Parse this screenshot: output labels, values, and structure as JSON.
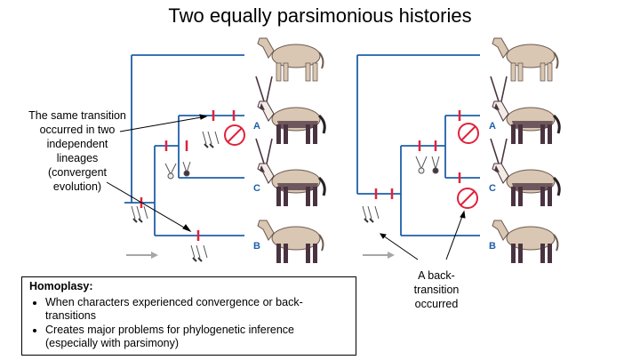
{
  "title": "Two equally parsimonious histories",
  "left_tree": {
    "tip_labels": [
      "A",
      "C",
      "B"
    ],
    "callout": "The same transition occurred in two independent lineages (convergent evolution)"
  },
  "right_tree": {
    "tip_labels": [
      "A",
      "C",
      "B"
    ],
    "callout": "A back-transition occurred"
  },
  "homoplasy": {
    "heading": "Homoplasy:",
    "bullets": [
      "When characters experienced convergence or back-transitions",
      "Creates major problems for phylogenetic inference (especially with parsimony)"
    ]
  },
  "colors": {
    "branch": "#1f5fa8",
    "transition_mark": "#e0223c",
    "animal_body": "#d9c7b4",
    "animal_dark": "#4a3340",
    "arrow_gray": "#a6a6a6"
  }
}
